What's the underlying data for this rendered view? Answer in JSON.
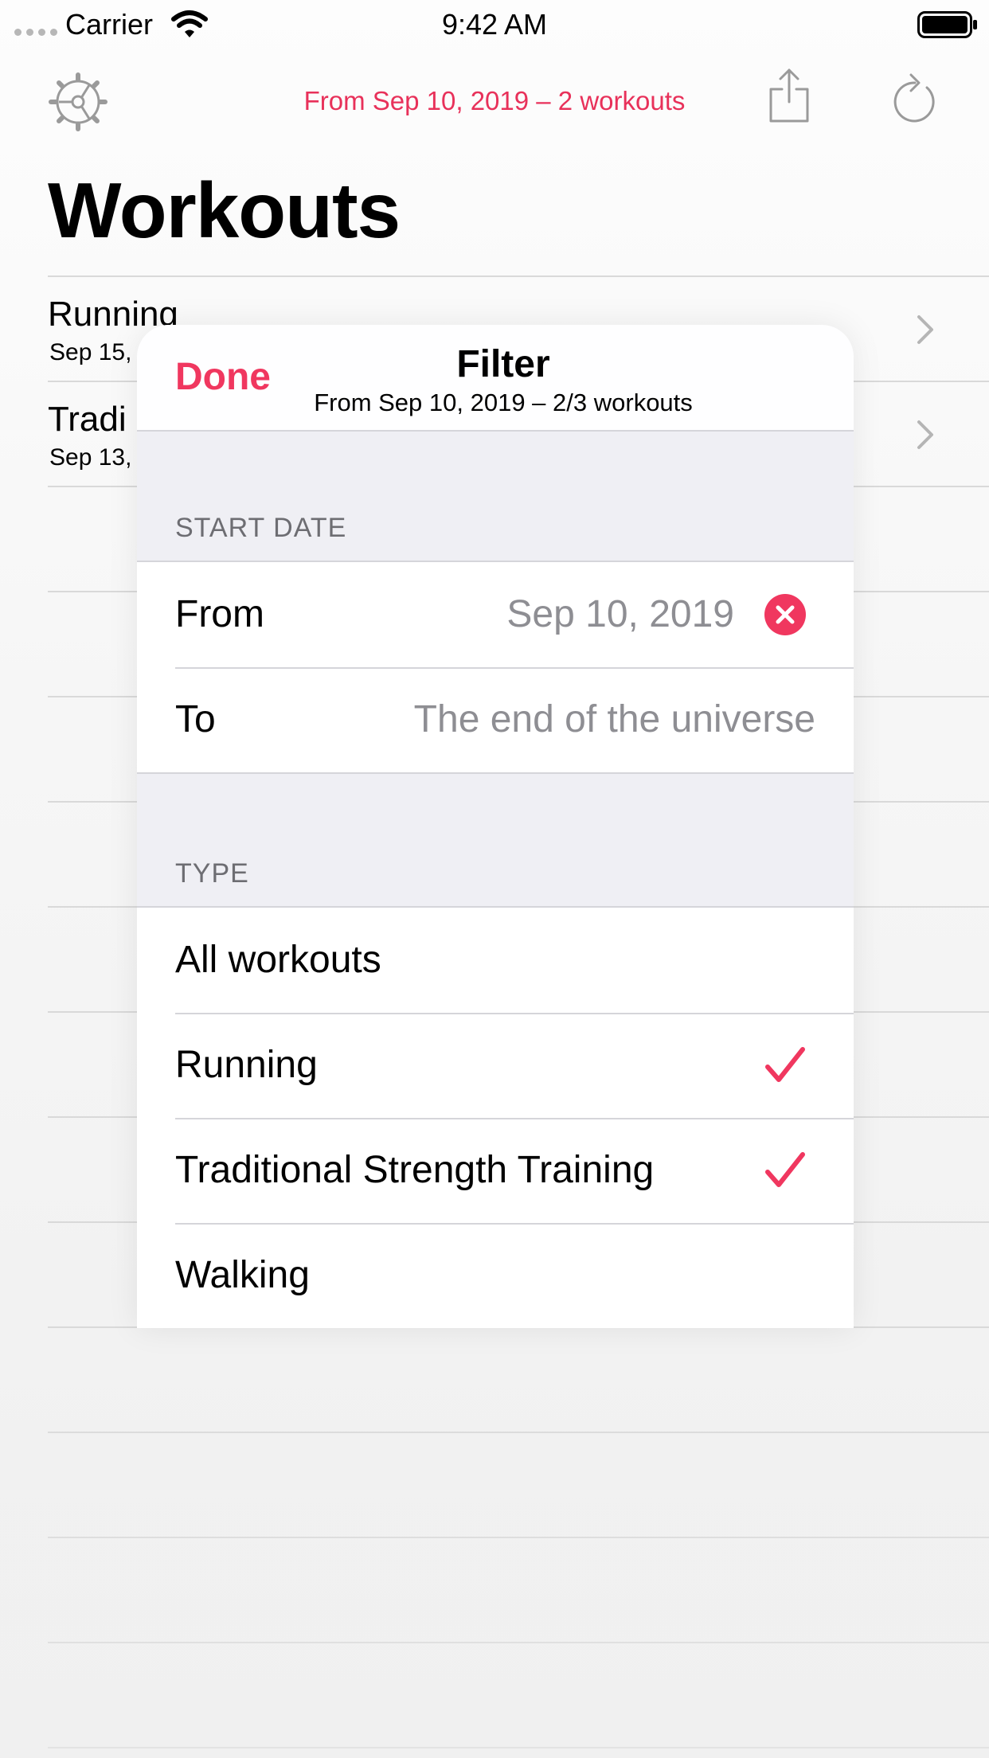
{
  "status_bar": {
    "carrier": "Carrier",
    "time": "9:42 AM"
  },
  "nav": {
    "subtitle": "From Sep 10, 2019 – 2 workouts",
    "title": "Workouts",
    "settings_icon": "gear-icon",
    "share_icon": "share-icon",
    "refresh_icon": "refresh-icon"
  },
  "workouts": [
    {
      "title": "Running",
      "date": "Sep 15,"
    },
    {
      "title": "Tradi",
      "date": "Sep 13,"
    }
  ],
  "filter": {
    "done_label": "Done",
    "title": "Filter",
    "subtitle": "From Sep 10, 2019 – 2/3 workouts",
    "start_date_header": "START DATE",
    "from_label": "From",
    "from_value": "Sep 10, 2019",
    "to_label": "To",
    "to_value": "The end of the universe",
    "type_header": "TYPE",
    "types": [
      {
        "label": "All workouts",
        "checked": false
      },
      {
        "label": "Running",
        "checked": true
      },
      {
        "label": "Traditional Strength Training",
        "checked": true
      },
      {
        "label": "Walking",
        "checked": false
      }
    ]
  },
  "colors": {
    "accent": "#f0375f",
    "secondary_text": "#8e8e93",
    "grouped_background": "#efeff4"
  }
}
